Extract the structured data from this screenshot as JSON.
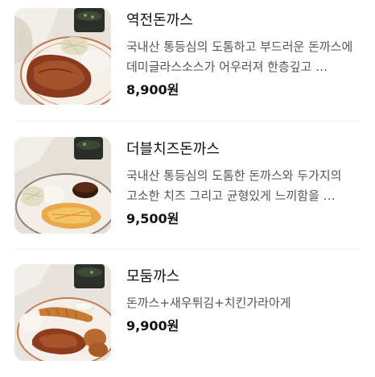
{
  "menu": {
    "items": [
      {
        "name": "역전돈까스",
        "description": "국내산 통등심의 도톰하고 부드러운 돈까스에 데미글라스소스가 어우러져 한층깊고 …",
        "price": "8,900원",
        "image_icon": "pork-cutlet-plate-icon"
      },
      {
        "name": "더블치즈돈까스",
        "description": "국내산 통등심의 도톰한 돈까스와 두가지의 고소한 치즈 그리고 균형있게 느끼함을 …",
        "price": "9,500원",
        "image_icon": "cheese-cutlet-plate-icon"
      },
      {
        "name": "모둠까스",
        "description": "돈까스+새우튀김+치킨가라아게",
        "price": "9,900원",
        "image_icon": "combo-cutlet-plate-icon"
      }
    ]
  },
  "colors": {
    "text_primary": "#111111",
    "text_secondary": "#555555",
    "divider": "#efefef",
    "background": "#ffffff"
  }
}
